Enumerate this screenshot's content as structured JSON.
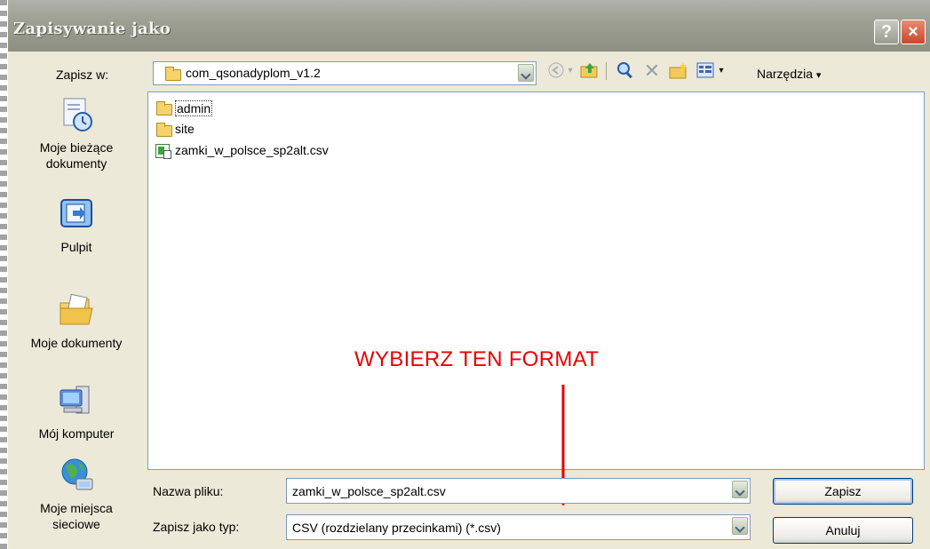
{
  "window": {
    "title": "Zapisywanie jako",
    "help_glyph": "?",
    "close_glyph": "×"
  },
  "save_in": {
    "label": "Zapisz w:",
    "value": "com_qsonadyplom_v1.2"
  },
  "toolbar": {
    "tools_menu_label": "Narzędzia"
  },
  "places": [
    {
      "label_line1": "Moje bieżące",
      "label_line2": "dokumenty",
      "icon": "recent-documents-icon"
    },
    {
      "label_line1": "Pulpit",
      "label_line2": "",
      "icon": "desktop-icon"
    },
    {
      "label_line1": "Moje dokumenty",
      "label_line2": "",
      "icon": "my-documents-icon"
    },
    {
      "label_line1": "Mój komputer",
      "label_line2": "",
      "icon": "my-computer-icon"
    },
    {
      "label_line1": "Moje miejsca",
      "label_line2": "sieciowe",
      "icon": "network-places-icon"
    }
  ],
  "files": [
    {
      "name": "admin",
      "type": "folder"
    },
    {
      "name": "site",
      "type": "folder"
    },
    {
      "name": "zamki_w_polsce_sp2alt.csv",
      "type": "csv"
    }
  ],
  "annotation": {
    "text": "WYBIERZ TEN FORMAT",
    "color": "#e80000"
  },
  "filename": {
    "label": "Nazwa pliku:",
    "value": "zamki_w_polsce_sp2alt.csv"
  },
  "filetype": {
    "label": "Zapisz jako typ:",
    "value": "CSV (rozdzielany przecinkami) (*.csv)"
  },
  "buttons": {
    "save": "Zapisz",
    "cancel": "Anuluj"
  }
}
